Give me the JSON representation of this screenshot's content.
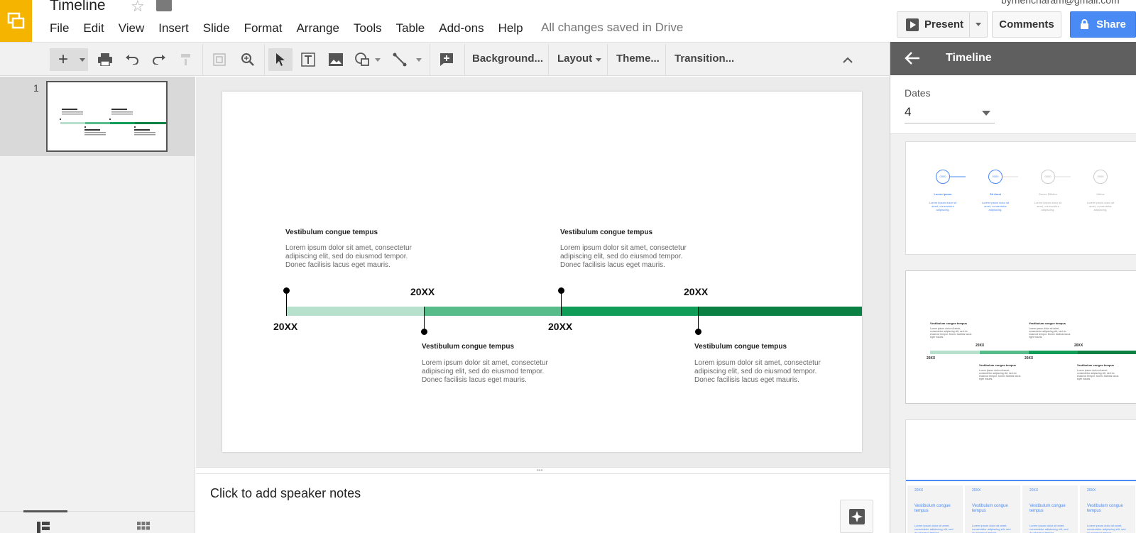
{
  "app": {
    "account": "bymencharam@gmail.com"
  },
  "doc": {
    "title": "Timeline",
    "save_status": "All changes saved in Drive"
  },
  "menu": [
    "File",
    "Edit",
    "View",
    "Insert",
    "Slide",
    "Format",
    "Arrange",
    "Tools",
    "Table",
    "Add-ons",
    "Help"
  ],
  "header_buttons": {
    "present": "Present",
    "comments": "Comments",
    "share": "Share"
  },
  "toolbar": {
    "background": "Background...",
    "layout": "Layout",
    "theme": "Theme...",
    "transition": "Transition..."
  },
  "filmstrip": {
    "slide_number": "1"
  },
  "slide": {
    "heading": "Vestibulum congue tempus",
    "body": "Lorem ipsum dolor sit amet, consectetur adipiscing elit, sed do eiusmod tempor. Donec facilisis lacus eget mauris.",
    "year": "20XX",
    "bar_colors": [
      "#b7e1cd",
      "#57bb8a",
      "#0f9d58",
      "#0b8043"
    ]
  },
  "notes": {
    "placeholder": "Click to add speaker notes"
  },
  "panel": {
    "title": "Timeline",
    "dates_label": "Dates",
    "dates_value": "4",
    "card1": {
      "labels": [
        "Lorem Ipsum",
        "Sit Amet",
        "Donec Efficitur",
        "Ultrice"
      ],
      "desc": "Lorem ipsum dolor sit amet, consectetur adipiscing.",
      "circle_text": "0000"
    },
    "card3": {
      "year": "20XX",
      "heading": "Vestibulum congue tempus",
      "body": "Lorem ipsum dolor sit amet, consectetur adipiscing elit, sed do eiusmod tempor."
    }
  },
  "colors": {
    "accent_blue": "#4a8af4",
    "logo_yellow": "#f4b400",
    "panel_header": "#5f5f5f"
  }
}
